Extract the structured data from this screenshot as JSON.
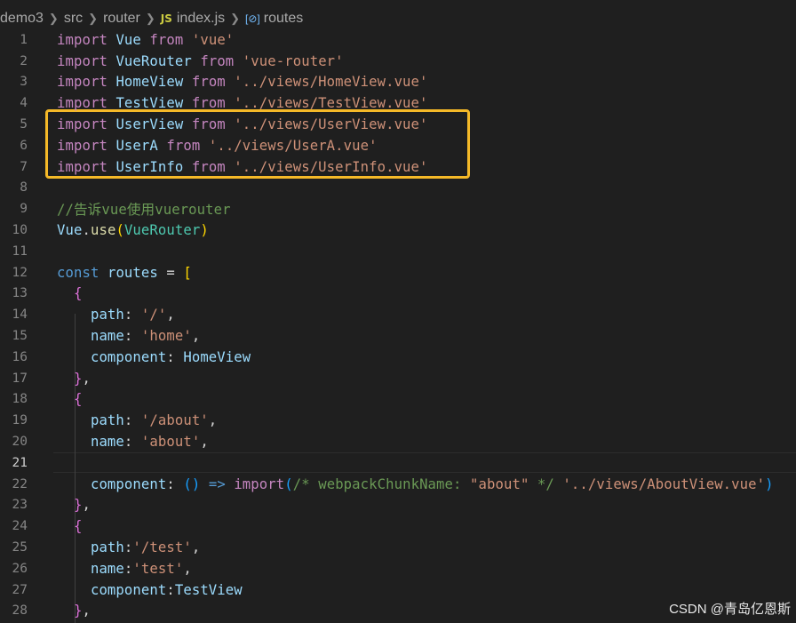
{
  "breadcrumb": {
    "items": [
      "demo3",
      "src",
      "router",
      "index.js",
      "routes"
    ],
    "file_icon": "JS",
    "symbol_icon": "[⊘]"
  },
  "editor": {
    "active_line": 21,
    "lines": [
      [
        [
          "kw",
          "import"
        ],
        [
          "p",
          " "
        ],
        [
          "var",
          "Vue"
        ],
        [
          "p",
          " "
        ],
        [
          "kw",
          "from"
        ],
        [
          "p",
          " "
        ],
        [
          "str",
          "'vue'"
        ]
      ],
      [
        [
          "kw",
          "import"
        ],
        [
          "p",
          " "
        ],
        [
          "var",
          "VueRouter"
        ],
        [
          "p",
          " "
        ],
        [
          "kw",
          "from"
        ],
        [
          "p",
          " "
        ],
        [
          "str",
          "'vue-router'"
        ]
      ],
      [
        [
          "kw",
          "import"
        ],
        [
          "p",
          " "
        ],
        [
          "var",
          "HomeView"
        ],
        [
          "p",
          " "
        ],
        [
          "kw",
          "from"
        ],
        [
          "p",
          " "
        ],
        [
          "str",
          "'../views/HomeView.vue'"
        ]
      ],
      [
        [
          "kw",
          "import"
        ],
        [
          "p",
          " "
        ],
        [
          "var",
          "TestView"
        ],
        [
          "p",
          " "
        ],
        [
          "kw",
          "from"
        ],
        [
          "p",
          " "
        ],
        [
          "str",
          "'../views/TestView.vue'"
        ]
      ],
      [
        [
          "kw",
          "import"
        ],
        [
          "p",
          " "
        ],
        [
          "var",
          "UserView"
        ],
        [
          "p",
          " "
        ],
        [
          "kw",
          "from"
        ],
        [
          "p",
          " "
        ],
        [
          "str",
          "'../views/UserView.vue'"
        ]
      ],
      [
        [
          "kw",
          "import"
        ],
        [
          "p",
          " "
        ],
        [
          "var",
          "UserA"
        ],
        [
          "p",
          " "
        ],
        [
          "kw",
          "from"
        ],
        [
          "p",
          " "
        ],
        [
          "str",
          "'../views/UserA.vue'"
        ]
      ],
      [
        [
          "kw",
          "import"
        ],
        [
          "p",
          " "
        ],
        [
          "var",
          "UserInfo"
        ],
        [
          "p",
          " "
        ],
        [
          "kw",
          "from"
        ],
        [
          "p",
          " "
        ],
        [
          "str",
          "'../views/UserInfo.vue'"
        ]
      ],
      [],
      [
        [
          "cmt",
          "//告诉vue使用vuerouter"
        ]
      ],
      [
        [
          "var",
          "Vue"
        ],
        [
          "p",
          "."
        ],
        [
          "fn",
          "use"
        ],
        [
          "br1",
          "("
        ],
        [
          "cls",
          "VueRouter"
        ],
        [
          "br1",
          ")"
        ]
      ],
      [],
      [
        [
          "blue",
          "const"
        ],
        [
          "p",
          " "
        ],
        [
          "var",
          "routes"
        ],
        [
          "p",
          " = "
        ],
        [
          "br1",
          "["
        ]
      ],
      [
        [
          "p",
          "  "
        ],
        [
          "br2",
          "{"
        ]
      ],
      [
        [
          "p",
          "    "
        ],
        [
          "var",
          "path"
        ],
        [
          "p",
          ": "
        ],
        [
          "str",
          "'/'"
        ],
        [
          "p",
          ","
        ]
      ],
      [
        [
          "p",
          "    "
        ],
        [
          "var",
          "name"
        ],
        [
          "p",
          ": "
        ],
        [
          "str",
          "'home'"
        ],
        [
          "p",
          ","
        ]
      ],
      [
        [
          "p",
          "    "
        ],
        [
          "var",
          "component"
        ],
        [
          "p",
          ": "
        ],
        [
          "var",
          "HomeView"
        ]
      ],
      [
        [
          "p",
          "  "
        ],
        [
          "br2",
          "}"
        ],
        [
          "p",
          ","
        ]
      ],
      [
        [
          "p",
          "  "
        ],
        [
          "br2",
          "{"
        ]
      ],
      [
        [
          "p",
          "    "
        ],
        [
          "var",
          "path"
        ],
        [
          "p",
          ": "
        ],
        [
          "str",
          "'/about'"
        ],
        [
          "p",
          ","
        ]
      ],
      [
        [
          "p",
          "    "
        ],
        [
          "var",
          "name"
        ],
        [
          "p",
          ": "
        ],
        [
          "str",
          "'about'"
        ],
        [
          "p",
          ","
        ]
      ],
      [],
      [
        [
          "p",
          "    "
        ],
        [
          "var",
          "component"
        ],
        [
          "p",
          ": "
        ],
        [
          "br3",
          "()"
        ],
        [
          "p",
          " "
        ],
        [
          "blue",
          "=>"
        ],
        [
          "p",
          " "
        ],
        [
          "kw",
          "import"
        ],
        [
          "br3",
          "("
        ],
        [
          "cmt",
          "/* webpackChunkName: "
        ],
        [
          "str",
          "\"about\""
        ],
        [
          "cmt",
          " */"
        ],
        [
          "p",
          " "
        ],
        [
          "str",
          "'../views/AboutView.vue'"
        ],
        [
          "br3",
          ")"
        ]
      ],
      [
        [
          "p",
          "  "
        ],
        [
          "br2",
          "}"
        ],
        [
          "p",
          ","
        ]
      ],
      [
        [
          "p",
          "  "
        ],
        [
          "br2",
          "{"
        ]
      ],
      [
        [
          "p",
          "    "
        ],
        [
          "var",
          "path"
        ],
        [
          "p",
          ":"
        ],
        [
          "str",
          "'/test'"
        ],
        [
          "p",
          ","
        ]
      ],
      [
        [
          "p",
          "    "
        ],
        [
          "var",
          "name"
        ],
        [
          "p",
          ":"
        ],
        [
          "str",
          "'test'"
        ],
        [
          "p",
          ","
        ]
      ],
      [
        [
          "p",
          "    "
        ],
        [
          "var",
          "component"
        ],
        [
          "p",
          ":"
        ],
        [
          "var",
          "TestView"
        ]
      ],
      [
        [
          "p",
          "  "
        ],
        [
          "br2",
          "}"
        ],
        [
          "p",
          ","
        ]
      ]
    ]
  },
  "watermark": "CSDN @青岛亿恩斯",
  "colors": {
    "background": "#1f1f1f",
    "keyword": "#c586c0",
    "variable": "#9cdcfe",
    "string": "#ce9178",
    "comment": "#6a9955",
    "highlight_box": "#f5b928"
  }
}
